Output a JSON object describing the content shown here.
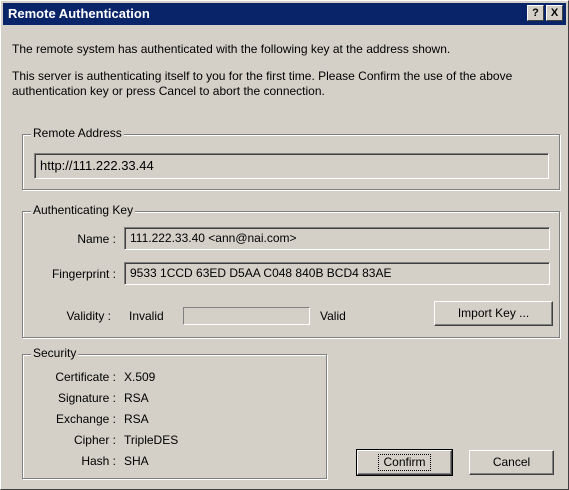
{
  "window": {
    "title": "Remote Authentication"
  },
  "titlebar": {
    "help_glyph": "?",
    "close_glyph": "X"
  },
  "message": {
    "line1": "The remote system has authenticated with the following key at the address shown.",
    "line2": "This server is authenticating itself to you for the first time.  Please Confirm the use of the above authentication key or press Cancel to abort the connection."
  },
  "remote_address": {
    "legend": "Remote Address",
    "value": "http://111.222.33.44"
  },
  "authenticating_key": {
    "legend": "Authenticating Key",
    "name_label": "Name :",
    "name_value": "111.222.33.40   <ann@nai.com>",
    "fingerprint_label": "Fingerprint :",
    "fingerprint_value": "9533 1CCD 63ED D5AA  C048 840B BCD4 83AE",
    "validity_label": "Validity :",
    "validity_low": "Invalid",
    "validity_high": "Valid",
    "validity_level": 0,
    "import_button": "Import Key ..."
  },
  "security": {
    "legend": "Security",
    "rows": [
      {
        "label": "Certificate :",
        "value": "X.509"
      },
      {
        "label": "Signature :",
        "value": "RSA"
      },
      {
        "label": "Exchange :",
        "value": "RSA"
      },
      {
        "label": "Cipher :",
        "value": "TripleDES"
      },
      {
        "label": "Hash :",
        "value": "SHA"
      }
    ]
  },
  "buttons": {
    "confirm": "Confirm",
    "cancel": "Cancel"
  }
}
